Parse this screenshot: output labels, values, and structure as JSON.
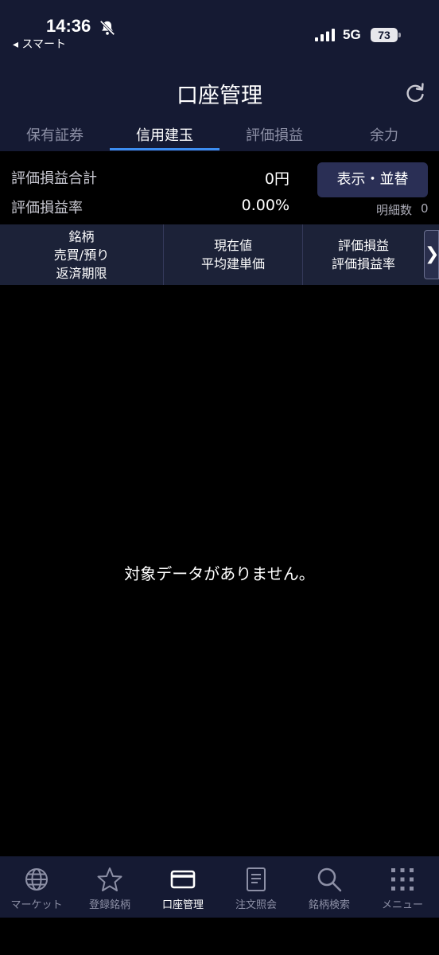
{
  "status_bar": {
    "time": "14:36",
    "back_app": "◂ スマート",
    "network": "5G",
    "battery": "73"
  },
  "header": {
    "title": "口座管理",
    "tabs": [
      {
        "label": "保有証券",
        "active": false
      },
      {
        "label": "信用建玉",
        "active": true
      },
      {
        "label": "評価損益",
        "active": false
      },
      {
        "label": "余力",
        "active": false
      }
    ]
  },
  "summary": {
    "total_label": "評価損益合計",
    "total_value": "0円",
    "rate_label": "評価損益率",
    "rate_value": "0.00%",
    "display_button": "表示・並替",
    "count_label": "明細数",
    "count_value": "0"
  },
  "columns": {
    "col1": [
      "銘柄",
      "売買/預り",
      "返済期限"
    ],
    "col2": [
      "現在値",
      "平均建単価"
    ],
    "col3": [
      "評価損益",
      "評価損益率"
    ],
    "more": "❯"
  },
  "empty_message": "対象データがありません。",
  "bottom_nav": [
    {
      "label": "マーケット",
      "icon": "globe-icon",
      "active": false
    },
    {
      "label": "登録銘柄",
      "icon": "star-icon",
      "active": false
    },
    {
      "label": "口座管理",
      "icon": "card-icon",
      "active": true
    },
    {
      "label": "注文照会",
      "icon": "document-icon",
      "active": false
    },
    {
      "label": "銘柄検索",
      "icon": "search-icon",
      "active": false
    },
    {
      "label": "メニュー",
      "icon": "grid-menu-icon",
      "active": false
    }
  ],
  "colors": {
    "header_bg": "#151a33",
    "accent": "#3d8df0",
    "button_bg": "#2a2f55"
  }
}
